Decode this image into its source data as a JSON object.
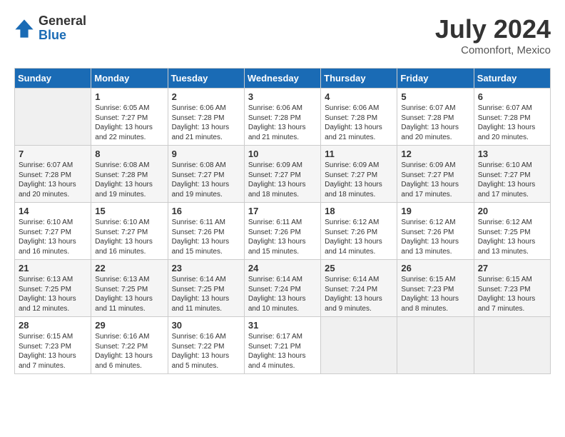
{
  "header": {
    "logo_general": "General",
    "logo_blue": "Blue",
    "month_title": "July 2024",
    "location": "Comonfort, Mexico"
  },
  "weekdays": [
    "Sunday",
    "Monday",
    "Tuesday",
    "Wednesday",
    "Thursday",
    "Friday",
    "Saturday"
  ],
  "weeks": [
    [
      {
        "day": "",
        "empty": true
      },
      {
        "day": "1",
        "sunrise": "6:05 AM",
        "sunset": "7:27 PM",
        "daylight": "13 hours and 22 minutes."
      },
      {
        "day": "2",
        "sunrise": "6:06 AM",
        "sunset": "7:28 PM",
        "daylight": "13 hours and 21 minutes."
      },
      {
        "day": "3",
        "sunrise": "6:06 AM",
        "sunset": "7:28 PM",
        "daylight": "13 hours and 21 minutes."
      },
      {
        "day": "4",
        "sunrise": "6:06 AM",
        "sunset": "7:28 PM",
        "daylight": "13 hours and 21 minutes."
      },
      {
        "day": "5",
        "sunrise": "6:07 AM",
        "sunset": "7:28 PM",
        "daylight": "13 hours and 20 minutes."
      },
      {
        "day": "6",
        "sunrise": "6:07 AM",
        "sunset": "7:28 PM",
        "daylight": "13 hours and 20 minutes."
      }
    ],
    [
      {
        "day": "7",
        "sunrise": "6:07 AM",
        "sunset": "7:28 PM",
        "daylight": "13 hours and 20 minutes."
      },
      {
        "day": "8",
        "sunrise": "6:08 AM",
        "sunset": "7:28 PM",
        "daylight": "13 hours and 19 minutes."
      },
      {
        "day": "9",
        "sunrise": "6:08 AM",
        "sunset": "7:27 PM",
        "daylight": "13 hours and 19 minutes."
      },
      {
        "day": "10",
        "sunrise": "6:09 AM",
        "sunset": "7:27 PM",
        "daylight": "13 hours and 18 minutes."
      },
      {
        "day": "11",
        "sunrise": "6:09 AM",
        "sunset": "7:27 PM",
        "daylight": "13 hours and 18 minutes."
      },
      {
        "day": "12",
        "sunrise": "6:09 AM",
        "sunset": "7:27 PM",
        "daylight": "13 hours and 17 minutes."
      },
      {
        "day": "13",
        "sunrise": "6:10 AM",
        "sunset": "7:27 PM",
        "daylight": "13 hours and 17 minutes."
      }
    ],
    [
      {
        "day": "14",
        "sunrise": "6:10 AM",
        "sunset": "7:27 PM",
        "daylight": "13 hours and 16 minutes."
      },
      {
        "day": "15",
        "sunrise": "6:10 AM",
        "sunset": "7:27 PM",
        "daylight": "13 hours and 16 minutes."
      },
      {
        "day": "16",
        "sunrise": "6:11 AM",
        "sunset": "7:26 PM",
        "daylight": "13 hours and 15 minutes."
      },
      {
        "day": "17",
        "sunrise": "6:11 AM",
        "sunset": "7:26 PM",
        "daylight": "13 hours and 15 minutes."
      },
      {
        "day": "18",
        "sunrise": "6:12 AM",
        "sunset": "7:26 PM",
        "daylight": "13 hours and 14 minutes."
      },
      {
        "day": "19",
        "sunrise": "6:12 AM",
        "sunset": "7:26 PM",
        "daylight": "13 hours and 13 minutes."
      },
      {
        "day": "20",
        "sunrise": "6:12 AM",
        "sunset": "7:25 PM",
        "daylight": "13 hours and 13 minutes."
      }
    ],
    [
      {
        "day": "21",
        "sunrise": "6:13 AM",
        "sunset": "7:25 PM",
        "daylight": "13 hours and 12 minutes."
      },
      {
        "day": "22",
        "sunrise": "6:13 AM",
        "sunset": "7:25 PM",
        "daylight": "13 hours and 11 minutes."
      },
      {
        "day": "23",
        "sunrise": "6:14 AM",
        "sunset": "7:25 PM",
        "daylight": "13 hours and 11 minutes."
      },
      {
        "day": "24",
        "sunrise": "6:14 AM",
        "sunset": "7:24 PM",
        "daylight": "13 hours and 10 minutes."
      },
      {
        "day": "25",
        "sunrise": "6:14 AM",
        "sunset": "7:24 PM",
        "daylight": "13 hours and 9 minutes."
      },
      {
        "day": "26",
        "sunrise": "6:15 AM",
        "sunset": "7:23 PM",
        "daylight": "13 hours and 8 minutes."
      },
      {
        "day": "27",
        "sunrise": "6:15 AM",
        "sunset": "7:23 PM",
        "daylight": "13 hours and 7 minutes."
      }
    ],
    [
      {
        "day": "28",
        "sunrise": "6:15 AM",
        "sunset": "7:23 PM",
        "daylight": "13 hours and 7 minutes."
      },
      {
        "day": "29",
        "sunrise": "6:16 AM",
        "sunset": "7:22 PM",
        "daylight": "13 hours and 6 minutes."
      },
      {
        "day": "30",
        "sunrise": "6:16 AM",
        "sunset": "7:22 PM",
        "daylight": "13 hours and 5 minutes."
      },
      {
        "day": "31",
        "sunrise": "6:17 AM",
        "sunset": "7:21 PM",
        "daylight": "13 hours and 4 minutes."
      },
      {
        "day": "",
        "empty": true
      },
      {
        "day": "",
        "empty": true
      },
      {
        "day": "",
        "empty": true
      }
    ]
  ],
  "labels": {
    "sunrise_prefix": "Sunrise: ",
    "sunset_prefix": "Sunset: ",
    "daylight_prefix": "Daylight: "
  }
}
